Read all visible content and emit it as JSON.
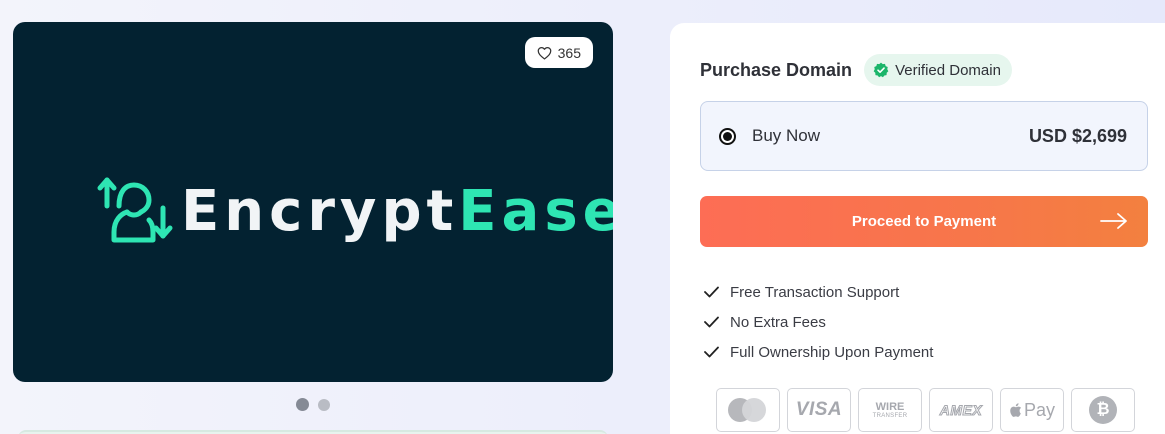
{
  "gallery": {
    "likes": "365",
    "brand": {
      "part1": "Encrypt",
      "part2": "Ease"
    },
    "colors": {
      "background": "#032231",
      "accent": "#2ee5b3"
    },
    "slides": [
      {
        "active": true
      },
      {
        "active": false
      }
    ]
  },
  "purchase": {
    "title": "Purchase Domain",
    "verified_label": "Verified Domain",
    "option": {
      "label": "Buy Now",
      "price": "USD $2,699",
      "selected": true
    },
    "proceed_label": "Proceed to Payment",
    "button_colors": [
      "#fd6d55",
      "#f3803f"
    ],
    "features": [
      "Free Transaction Support",
      "No Extra Fees",
      "Full Ownership Upon Payment"
    ],
    "payment_methods": {
      "mastercard": "mastercard-icon",
      "visa": "VISA",
      "wire_top": "WIRE",
      "wire_bottom": "TRANSFER",
      "amex": "AMEX",
      "applepay": "Pay",
      "bitcoin": "₿"
    }
  }
}
